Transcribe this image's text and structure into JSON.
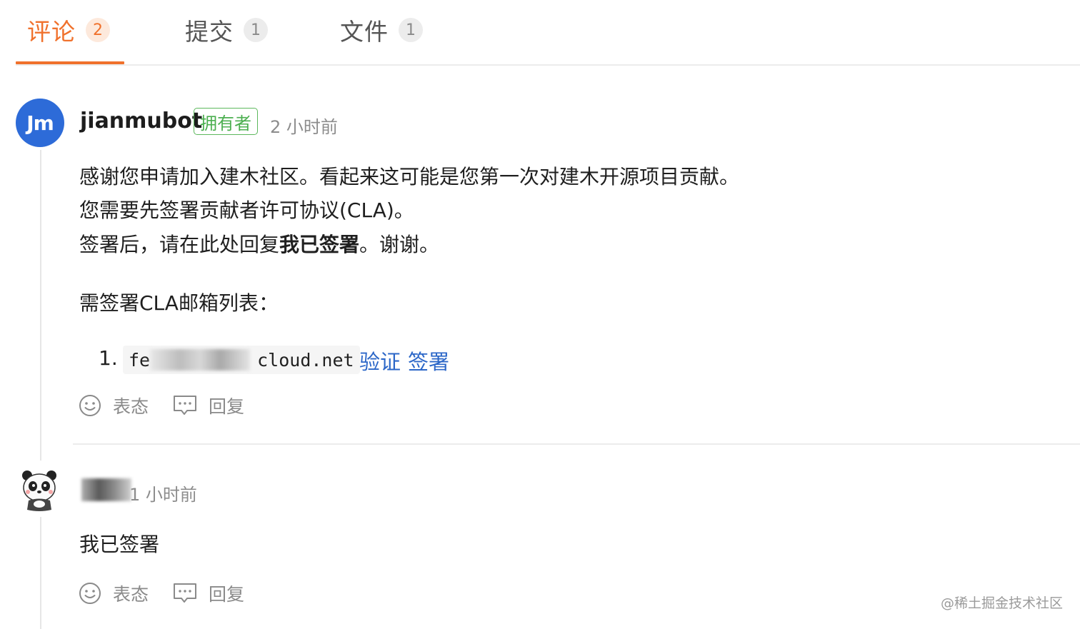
{
  "tabs": [
    {
      "label": "评论",
      "count": "2",
      "active": true
    },
    {
      "label": "提交",
      "count": "1",
      "active": false
    },
    {
      "label": "文件",
      "count": "1",
      "active": false
    }
  ],
  "comments": [
    {
      "avatar_text": "Jm",
      "author": "jianmubot",
      "badge": "拥有者",
      "time": "2 小时前",
      "paragraphs": [
        "感谢您申请加入建木社区。看起来这可能是您第一次对建木开源项目贡献。",
        "您需要先签署贡献者许可协议(CLA)。"
      ],
      "line3_prefix": "签署后，请在此处回复",
      "line3_bold": "我已签署",
      "line3_suffix": "。谢谢。",
      "list_title": "需签署CLA邮箱列表：",
      "list_number": "1.",
      "email_visible_start": "fe",
      "email_visible_end": "cloud.net",
      "link_verify": "验证",
      "link_sign": "签署",
      "action_react": "表态",
      "action_reply": "回复"
    },
    {
      "time": "1 小时前",
      "text": "我已签署",
      "action_react": "表态",
      "action_reply": "回复"
    }
  ],
  "watermark": "@稀土掘金技术社区",
  "colors": {
    "accent": "#f0712c",
    "link": "#2c67c8",
    "owner_badge": "#4caf50",
    "avatar_bg": "#2d6bd8"
  }
}
